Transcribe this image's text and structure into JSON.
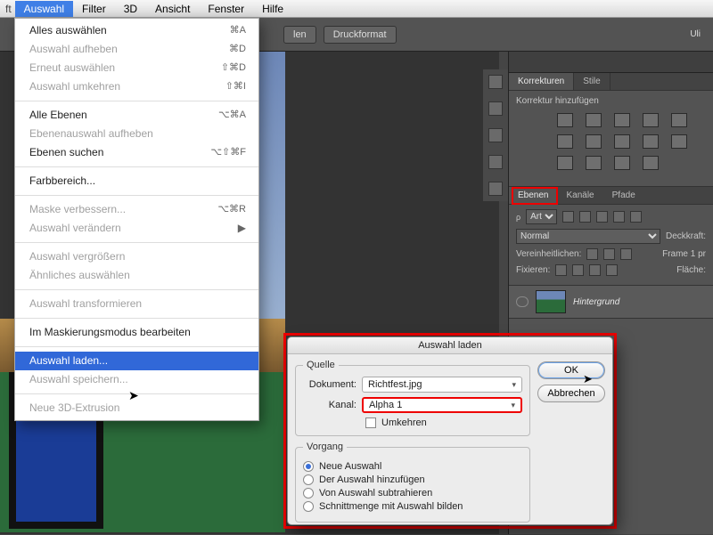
{
  "menubar": {
    "prefix": "ft",
    "items": [
      "Auswahl",
      "Filter",
      "3D",
      "Ansicht",
      "Fenster",
      "Hilfe"
    ],
    "selected": 0
  },
  "toolbar": {
    "unknown_btn": "len",
    "druck": "Druckformat",
    "user": "Uli"
  },
  "dropdown": {
    "groups": [
      [
        {
          "label": "Alles auswählen",
          "sc": "⌘A"
        },
        {
          "label": "Auswahl aufheben",
          "sc": "⌘D",
          "dis": true
        },
        {
          "label": "Erneut auswählen",
          "sc": "⇧⌘D",
          "dis": true
        },
        {
          "label": "Auswahl umkehren",
          "sc": "⇧⌘I",
          "dis": true
        }
      ],
      [
        {
          "label": "Alle Ebenen",
          "sc": "⌥⌘A"
        },
        {
          "label": "Ebenenauswahl aufheben",
          "dis": true
        },
        {
          "label": "Ebenen suchen",
          "sc": "⌥⇧⌘F"
        }
      ],
      [
        {
          "label": "Farbbereich..."
        }
      ],
      [
        {
          "label": "Maske verbessern...",
          "sc": "⌥⌘R",
          "dis": true
        },
        {
          "label": "Auswahl verändern",
          "sub": true,
          "dis": true
        }
      ],
      [
        {
          "label": "Auswahl vergrößern",
          "dis": true
        },
        {
          "label": "Ähnliches auswählen",
          "dis": true
        }
      ],
      [
        {
          "label": "Auswahl transformieren",
          "dis": true
        }
      ],
      [
        {
          "label": "Im Maskierungsmodus bearbeiten"
        }
      ],
      [
        {
          "label": "Auswahl laden...",
          "sel": true
        },
        {
          "label": "Auswahl speichern...",
          "dis": true
        }
      ],
      [
        {
          "label": "Neue 3D-Extrusion",
          "dis": true
        }
      ]
    ]
  },
  "adjust": {
    "tabs": [
      "Korrekturen",
      "Stile"
    ],
    "heading": "Korrektur hinzufügen"
  },
  "layers": {
    "tabs": [
      "Ebenen",
      "Kanäle",
      "Pfade"
    ],
    "kind_label": "Art",
    "blend": "Normal",
    "opacity_label": "Deckkraft:",
    "unify": "Vereinheitlichen:",
    "frame": "Frame 1 pr",
    "lock": "Fixieren:",
    "fill": "Fläche:",
    "bg_layer": "Hintergrund"
  },
  "dialog": {
    "title": "Auswahl laden",
    "source_legend": "Quelle",
    "doc_label": "Dokument:",
    "doc_value": "Richtfest.jpg",
    "ch_label": "Kanal:",
    "ch_value": "Alpha 1",
    "invert": "Umkehren",
    "op_legend": "Vorgang",
    "ops": [
      "Neue Auswahl",
      "Der Auswahl hinzufügen",
      "Von Auswahl subtrahieren",
      "Schnittmenge mit Auswahl bilden"
    ],
    "op_selected": 0,
    "ok": "OK",
    "cancel": "Abbrechen"
  }
}
